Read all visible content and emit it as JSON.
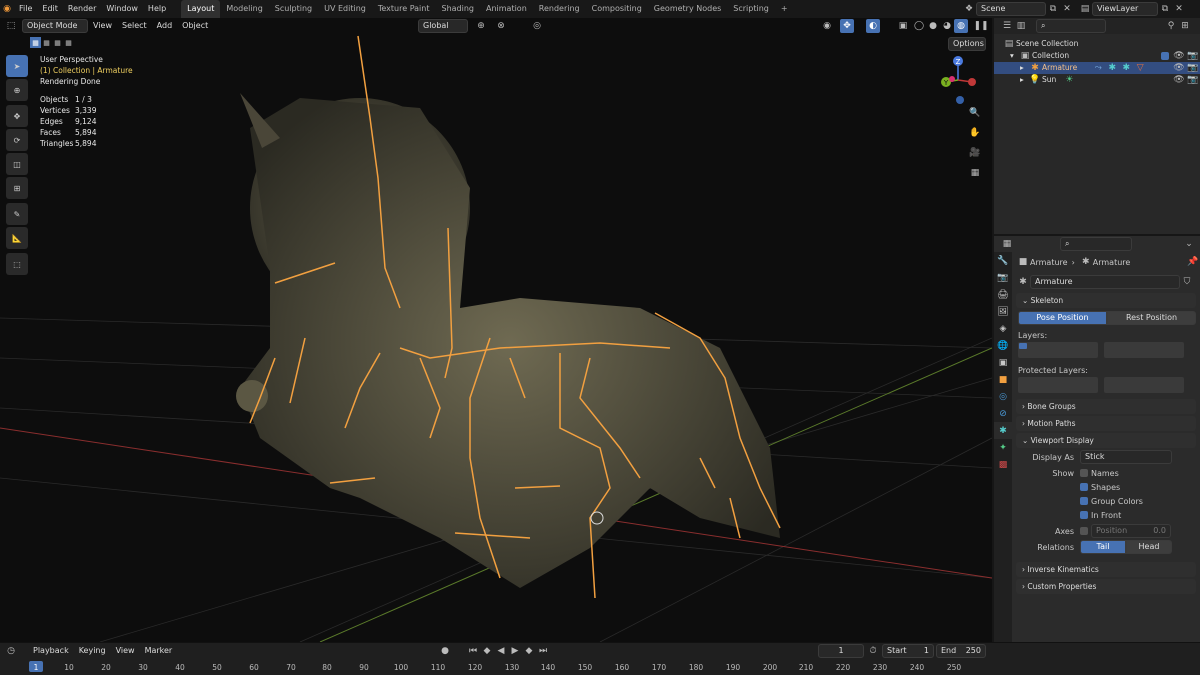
{
  "topbar": {
    "menus": [
      "File",
      "Edit",
      "Render",
      "Window",
      "Help"
    ],
    "workspaces": [
      "Layout",
      "Modeling",
      "Sculpting",
      "UV Editing",
      "Texture Paint",
      "Shading",
      "Animation",
      "Rendering",
      "Compositing",
      "Geometry Nodes",
      "Scripting"
    ],
    "add_tab": "+",
    "scene": "Scene",
    "view_layer": "ViewLayer"
  },
  "viewport": {
    "mode": "Object Mode",
    "menus": [
      "View",
      "Select",
      "Add",
      "Object"
    ],
    "transform": "Global",
    "options": "Options",
    "overlay": {
      "line1": "User Perspective",
      "line2": "(1) Collection | Armature",
      "line3": "Rendering Done"
    },
    "stats": [
      {
        "label": "Objects",
        "value": "1 / 3"
      },
      {
        "label": "Vertices",
        "value": "3,339"
      },
      {
        "label": "Edges",
        "value": "9,124"
      },
      {
        "label": "Faces",
        "value": "5,894"
      },
      {
        "label": "Triangles",
        "value": "5,894"
      }
    ],
    "gizmo": {
      "z": "Z",
      "y": "Y"
    }
  },
  "outliner": {
    "root": "Scene Collection",
    "collection": "Collection",
    "items": [
      "Armature",
      "Sun"
    ]
  },
  "properties": {
    "breadcrumb1": "Armature",
    "breadcrumb2": "Armature",
    "data_name": "Armature",
    "skeleton": "Skeleton",
    "pose": "Pose Position",
    "rest": "Rest Position",
    "layers": "Layers:",
    "protected": "Protected Layers:",
    "bone_groups": "Bone Groups",
    "motion_paths": "Motion Paths",
    "viewport_display": "Viewport Display",
    "display_as_label": "Display As",
    "display_as": "Stick",
    "show": "Show",
    "names": "Names",
    "shapes": "Shapes",
    "group_colors": "Group Colors",
    "in_front": "In Front",
    "axes": "Axes",
    "position": "Position",
    "position_val": "0.0",
    "relations": "Relations",
    "tail": "Tail",
    "head": "Head",
    "ik": "Inverse Kinematics",
    "custom": "Custom Properties"
  },
  "timeline": {
    "menus": [
      "Playback",
      "Keying",
      "View",
      "Marker"
    ],
    "current": "1",
    "start_label": "Start",
    "start": "1",
    "end_label": "End",
    "end": "250",
    "ticks": [
      "1",
      "10",
      "20",
      "30",
      "40",
      "50",
      "60",
      "70",
      "80",
      "90",
      "100",
      "110",
      "120",
      "130",
      "140",
      "150",
      "160",
      "170",
      "180",
      "190",
      "200",
      "210",
      "220",
      "230",
      "240",
      "250"
    ]
  }
}
